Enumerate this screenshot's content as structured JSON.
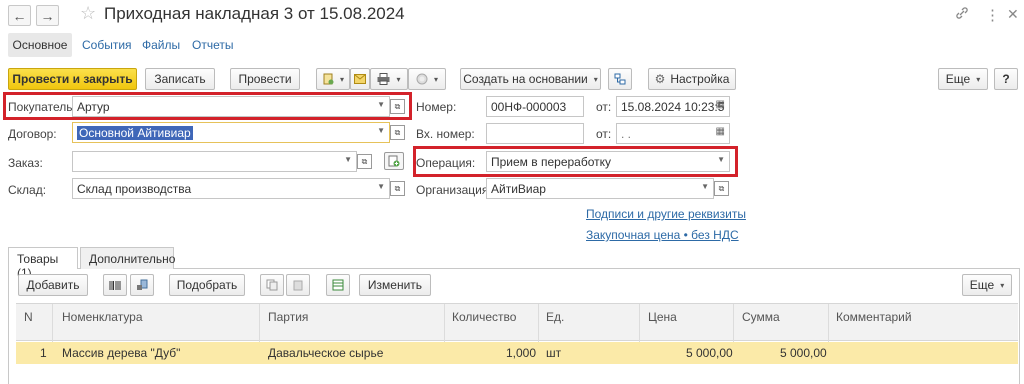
{
  "header": {
    "title": "Приходная накладная 3 от 15.08.2024",
    "back_icon": "←",
    "forward_icon": "→",
    "star_icon": "☆",
    "link_icon": "🔗",
    "more_icon": "⋮",
    "close_icon": "✕"
  },
  "nav": {
    "tabs": [
      "Основное",
      "События",
      "Файлы",
      "Отчеты"
    ]
  },
  "toolbar": {
    "post_close": "Провести и закрыть",
    "save": "Записать",
    "post": "Провести",
    "create_based": "Создать на основании",
    "settings": "Настройка",
    "more": "Еще",
    "help": "?"
  },
  "form": {
    "buyer_label": "Покупатель:",
    "buyer_value": "Артур",
    "contract_label": "Договор:",
    "contract_value": "Основной Айтивиар",
    "order_label": "Заказ:",
    "order_value": "",
    "warehouse_label": "Склад:",
    "warehouse_value": "Склад производства",
    "number_label": "Номер:",
    "number_value": "00НФ-000003",
    "date_from_label": "от:",
    "date_value": "15.08.2024 10:23:5",
    "in_number_label": "Вх. номер:",
    "in_number_value": "",
    "in_date_label": "от:",
    "in_date_value": " .  .",
    "operation_label": "Операция:",
    "operation_value": "Прием в переработку",
    "org_label": "Организация:",
    "org_value": "АйтиВиар",
    "signatures_link": "Подписи и другие реквизиты",
    "price_link": "Закупочная цена • без НДС"
  },
  "tabs_lower": [
    "Товары (1)",
    "Дополнительно"
  ],
  "goods_toolbar": {
    "add": "Добавить",
    "pick": "Подобрать",
    "change": "Изменить",
    "more": "Еще"
  },
  "table": {
    "columns": [
      "N",
      "Номенклатура",
      "Партия",
      "Количество",
      "Ед.",
      "Цена",
      "Сумма",
      "Комментарий"
    ],
    "rows": [
      {
        "n": "1",
        "item": "Массив дерева \"Дуб\"",
        "batch": "Давальческое сырье",
        "qty": "1,000",
        "unit": "шт",
        "price": "5 000,00",
        "sum": "5 000,00",
        "comment": ""
      }
    ]
  },
  "colors": {
    "accent_yellow": "#f0c60e",
    "highlight_red": "#d3222a",
    "link_blue": "#2d6aa6",
    "selected_row": "#fbeaa8"
  }
}
